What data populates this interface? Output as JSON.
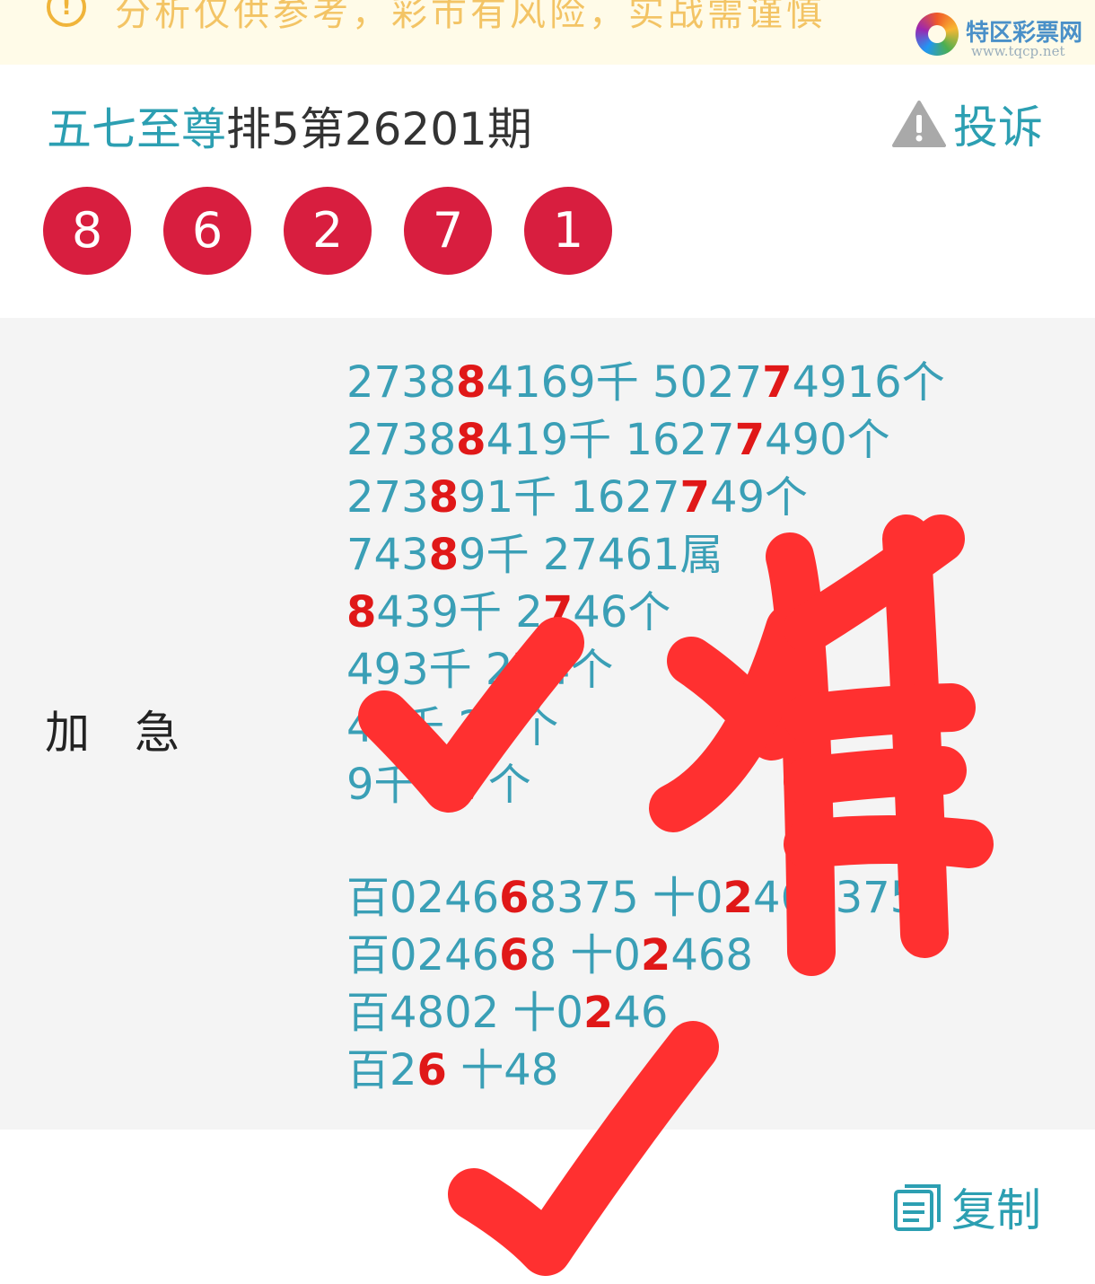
{
  "banner": {
    "text": "分析仅供参考，彩市有风险，实战需谨慎"
  },
  "watermark": {
    "title": "特区彩票网",
    "url": "www.tqcp.net"
  },
  "header": {
    "author": "五七至尊",
    "period": "排5第26201期",
    "complain_label": "投诉"
  },
  "balls": [
    "8",
    "6",
    "2",
    "7",
    "1"
  ],
  "section_label": "加急",
  "lines": [
    [
      [
        "2738",
        ""
      ],
      [
        "8",
        "hl"
      ],
      [
        "4169千 5027",
        ""
      ],
      [
        "7",
        "hl"
      ],
      [
        "4916个",
        ""
      ]
    ],
    [
      [
        "2738",
        ""
      ],
      [
        "8",
        "hl"
      ],
      [
        "419千 1627",
        ""
      ],
      [
        "7",
        "hl"
      ],
      [
        "490个",
        ""
      ]
    ],
    [
      [
        "273",
        ""
      ],
      [
        "8",
        "hl"
      ],
      [
        "91千 1627",
        ""
      ],
      [
        "7",
        "hl"
      ],
      [
        "49个",
        ""
      ]
    ],
    [
      [
        "743",
        ""
      ],
      [
        "8",
        "hl"
      ],
      [
        "9千 27461属",
        ""
      ]
    ],
    [
      [
        "8",
        "hl"
      ],
      [
        "439千 2",
        ""
      ],
      [
        "7",
        "hl"
      ],
      [
        "46个",
        ""
      ]
    ],
    [
      [
        "493千 2",
        ""
      ],
      [
        "7",
        "hl"
      ],
      [
        "4个",
        ""
      ]
    ],
    [
      [
        "49千 2",
        ""
      ],
      [
        "7",
        "hl"
      ],
      [
        "个",
        ""
      ]
    ],
    [
      [
        "9千 2",
        ""
      ],
      [
        "7",
        "hl"
      ],
      [
        "个",
        ""
      ]
    ],
    [],
    [
      [
        "百0246",
        ""
      ],
      [
        "6",
        "hl"
      ],
      [
        "8375 十0",
        ""
      ],
      [
        "2",
        "hl"
      ],
      [
        "468375",
        ""
      ]
    ],
    [
      [
        "百0246",
        ""
      ],
      [
        "6",
        "hl"
      ],
      [
        "8 十0",
        ""
      ],
      [
        "2",
        "hl"
      ],
      [
        "468",
        ""
      ]
    ],
    [
      [
        "百4802 十0",
        ""
      ],
      [
        "2",
        "hl"
      ],
      [
        "46",
        ""
      ]
    ],
    [
      [
        "百2",
        ""
      ],
      [
        "6",
        "hl"
      ],
      [
        " 十48",
        ""
      ]
    ]
  ],
  "footer": {
    "copy_label": "复制"
  },
  "colors": {
    "accent": "#2c9fb2",
    "ball": "#d81e3f",
    "highlight": "#e01818",
    "marker": "#ff3030"
  }
}
